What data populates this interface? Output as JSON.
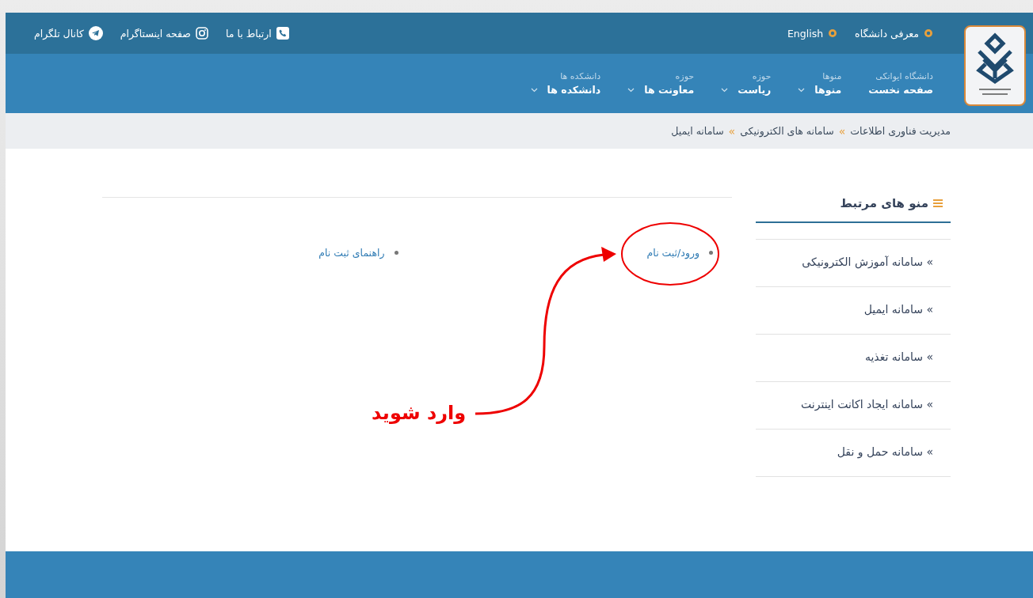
{
  "top_bar": {
    "right_links": [
      {
        "label": "معرفی دانشگاه"
      },
      {
        "label": "English"
      }
    ],
    "left_links": [
      {
        "kind": "phone",
        "label": "ارتباط با ما"
      },
      {
        "kind": "instagram",
        "label": "صفحه اینستاگرام"
      },
      {
        "kind": "telegram",
        "label": "کانال تلگرام"
      }
    ]
  },
  "nav": {
    "items": [
      {
        "caption": "دانشگاه ایوانکی",
        "label": "صفحه نخست",
        "has_dropdown": false
      },
      {
        "caption": "منوها",
        "label": "منوها",
        "has_dropdown": true
      },
      {
        "caption": "حوزه",
        "label": "ریاست",
        "has_dropdown": true
      },
      {
        "caption": "حوزه",
        "label": "معاونت ها",
        "has_dropdown": true
      },
      {
        "caption": "دانشکده ها",
        "label": "دانشکده ها",
        "has_dropdown": true
      }
    ]
  },
  "breadcrumb": {
    "items": [
      "مدیریت فناوری اطلاعات",
      "سامانه های الکترونیکی",
      "سامانه ایمیل"
    ],
    "separator": "»"
  },
  "sidebar": {
    "title": "منو های مرتبط",
    "items": [
      "» سامانه آموزش الکترونیکی",
      "» سامانه ایمیل",
      "» سامانه تغذیه",
      "» سامانه ایجاد اکانت اینترنت",
      "» سامانه حمل و نقل"
    ]
  },
  "main": {
    "links": [
      "ورود/ثبت نام",
      "راهنمای ثبت نام"
    ]
  },
  "annotation": {
    "text": "وارد شوید"
  }
}
